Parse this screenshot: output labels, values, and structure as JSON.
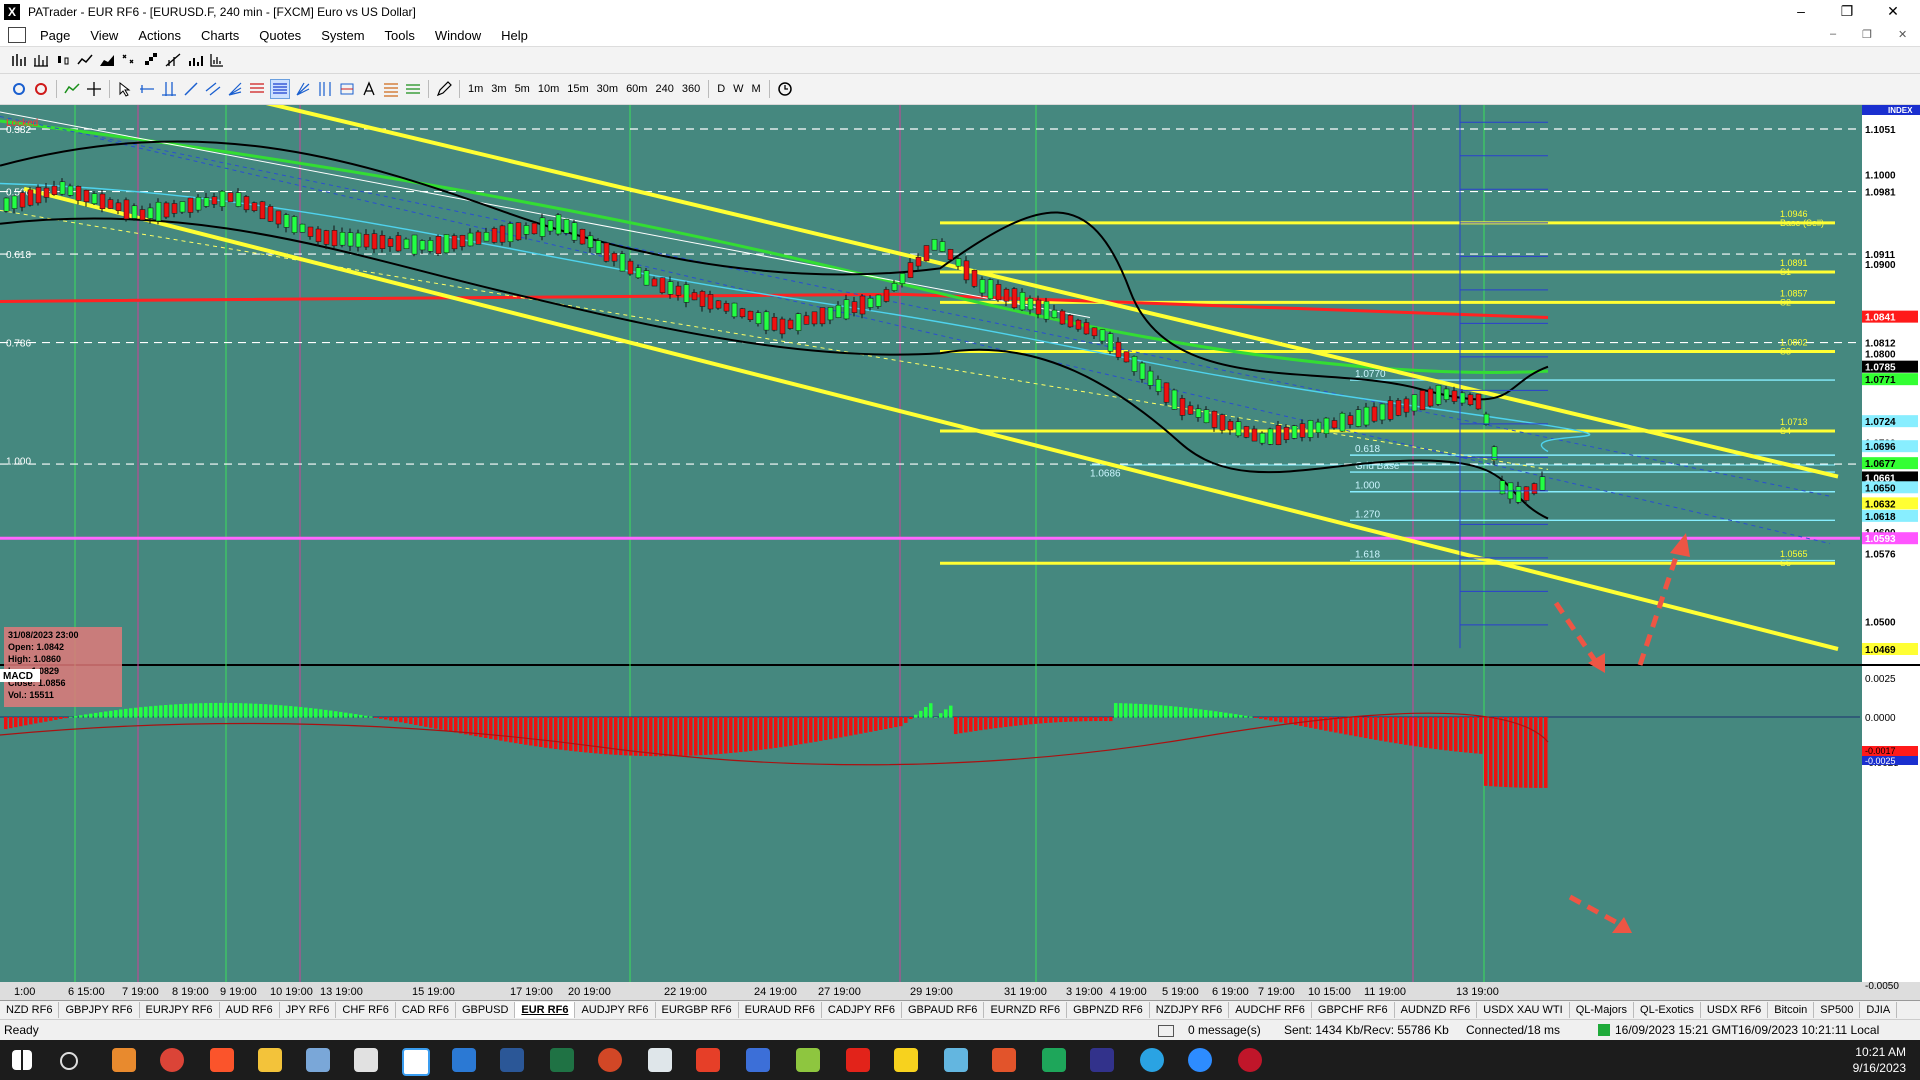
{
  "window": {
    "title": "PATrader - EUR RF6 - [EURUSD.F, 240 min - [FXCM] Euro vs US Dollar]",
    "app_icon": "X"
  },
  "menu": [
    "Page",
    "Actions",
    "Charts",
    "Quotes",
    "System",
    "Tools",
    "Window",
    "Help"
  ],
  "timeframes": [
    "1m",
    "3m",
    "5m",
    "10m",
    "15m",
    "30m",
    "60m",
    "240",
    "360",
    "D",
    "W",
    "M"
  ],
  "chart": {
    "locked_label": "Locked",
    "index_label": "INDEX",
    "price_labels": [
      {
        "text": "1.1051",
        "price": 1.1051,
        "bg": "#ffffff",
        "fg": "#000000"
      },
      {
        "text": "1.1000",
        "price": 1.1,
        "bg": "",
        "fg": "#000000"
      },
      {
        "text": "1.0981",
        "price": 1.0981,
        "bg": "#ffffff",
        "fg": "#000000"
      },
      {
        "text": "1.0911",
        "price": 1.0911,
        "bg": "#ffffff",
        "fg": "#000000"
      },
      {
        "text": "1.0900",
        "price": 1.09,
        "bg": "",
        "fg": "#000000"
      },
      {
        "text": "1.0841",
        "price": 1.0841,
        "bg": "#ff1a1a",
        "fg": "#ffffff"
      },
      {
        "text": "1.0812",
        "price": 1.0812,
        "bg": "#ffffff",
        "fg": "#000000"
      },
      {
        "text": "1.0800",
        "price": 1.08,
        "bg": "",
        "fg": "#000000"
      },
      {
        "text": "1.0785",
        "price": 1.0785,
        "bg": "#000000",
        "fg": "#ffffff"
      },
      {
        "text": "1.0771",
        "price": 1.0771,
        "bg": "#33ff33",
        "fg": "#000000"
      },
      {
        "text": "1.0724",
        "price": 1.0724,
        "bg": "#88eeff",
        "fg": "#000000"
      },
      {
        "text": "1.0700",
        "price": 1.07,
        "bg": "",
        "fg": "#000000"
      },
      {
        "text": "1.0696",
        "price": 1.0696,
        "bg": "#88eeff",
        "fg": "#000000"
      },
      {
        "text": "1.0677",
        "price": 1.0677,
        "bg": "#33ff33",
        "fg": "#000000"
      },
      {
        "text": "1.0661",
        "price": 1.0661,
        "bg": "#000000",
        "fg": "#ffffff"
      },
      {
        "text": "1.0650",
        "price": 1.065,
        "bg": "#88eeff",
        "fg": "#000000"
      },
      {
        "text": "1.0632",
        "price": 1.0632,
        "bg": "#ffff33",
        "fg": "#000000"
      },
      {
        "text": "1.0618",
        "price": 1.0618,
        "bg": "#88eeff",
        "fg": "#000000"
      },
      {
        "text": "1.0600",
        "price": 1.06,
        "bg": "",
        "fg": "#000000"
      },
      {
        "text": "1.0593",
        "price": 1.0593,
        "bg": "#ff55ff",
        "fg": "#ffffff"
      },
      {
        "text": "1.0576",
        "price": 1.0576,
        "bg": "#ffffff",
        "fg": "#000000"
      },
      {
        "text": "1.0500",
        "price": 1.05,
        "bg": "",
        "fg": "#000000"
      },
      {
        "text": "1.0469",
        "price": 1.0469,
        "bg": "#ffff33",
        "fg": "#000000"
      }
    ],
    "fib_left": [
      {
        "text": "0.382",
        "price": 1.1051
      },
      {
        "text": "0.500",
        "price": 1.0981
      },
      {
        "text": "0.618",
        "price": 1.0911
      },
      {
        "text": "0.786",
        "price": 1.0812
      },
      {
        "text": "1.000",
        "price": 1.068
      }
    ],
    "pivots": [
      {
        "text": "1.0946",
        "sub": "Base (Sell)",
        "price": 1.0946
      },
      {
        "text": "1.0891",
        "sub": "S1",
        "price": 1.0891
      },
      {
        "text": "1.0857",
        "sub": "S2",
        "price": 1.0857
      },
      {
        "text": "1.0802",
        "sub": "S3",
        "price": 1.0802
      },
      {
        "text": "1.0713",
        "sub": "S4",
        "price": 1.0713
      },
      {
        "text": "1.0565",
        "sub": "S5",
        "price": 1.0565
      }
    ],
    "grid_labels": [
      {
        "text": "1.0770",
        "price": 1.077
      },
      {
        "text": "0.618",
        "price": 1.0686
      },
      {
        "text": "Grid Base",
        "price": 1.0667
      },
      {
        "text": "1.000",
        "price": 1.0645
      },
      {
        "text": "1.270",
        "price": 1.0613
      },
      {
        "text": "1.618",
        "price": 1.0568
      }
    ],
    "fib_mid_label": "1.0686",
    "time_labels": [
      "1:00",
      "6 15:00",
      "7 19:00",
      "8 19:00",
      "9 19:00",
      "10 19:00",
      "13 19:00",
      "15 19:00",
      "17 19:00",
      "20 19:00",
      "22 19:00",
      "24 19:00",
      "27 19:00",
      "29 19:00",
      "31 19:00",
      "3 19:00",
      "4 19:00",
      "5 19:00",
      "6 19:00",
      "7 19:00",
      "10 15:00",
      "11 19:00",
      "13 19:00"
    ],
    "ohlc": {
      "date": "31/08/2023 23:00",
      "open": "Open: 1.0842",
      "high": "High: 1.0860",
      "low": "Low: 1.0829",
      "close": "Close: 1.0856",
      "vol": "Vol.: 15511"
    },
    "macd": {
      "label": "MACD",
      "levels": [
        "0.0025",
        "0.0000",
        "-0.0025",
        "-0.0050"
      ],
      "badge1": "-0.0017",
      "badge2": "-0.0025"
    }
  },
  "tabs": [
    "NZD RF6",
    "GBPJPY RF6",
    "EURJPY RF6",
    "AUD RF6",
    "JPY RF6",
    "CHF RF6",
    "CAD RF6",
    "GBPUSD",
    "EUR RF6",
    "AUDJPY RF6",
    "EURGBP RF6",
    "EURAUD RF6",
    "CADJPY RF6",
    "GBPAUD RF6",
    "EURNZD RF6",
    "GBPNZD RF6",
    "NZDJPY RF6",
    "AUDCHF RF6",
    "GBPCHF RF6",
    "AUDNZD RF6",
    "USDX XAU WTI",
    "QL-Majors",
    "QL-Exotics",
    "USDX RF6",
    "Bitcoin",
    "SP500",
    "DJIA"
  ],
  "active_tab": "EUR RF6",
  "status": {
    "ready": "Ready",
    "messages": "0 message(s)",
    "traffic": "Sent: 1434 Kb/Recv: 55786 Kb",
    "connected": "Connected/18 ms",
    "server_time": "16/09/2023 15:21 GMT",
    "local_time": "16/09/2023 10:21:11 Local"
  },
  "taskbar": {
    "time": "10:21 AM",
    "date": "9/16/2023"
  },
  "colors": {
    "chart_bg": "#45887f",
    "bull": "#22ff44",
    "bear": "#ee1111",
    "channel": "#ffff33",
    "arrow": "#ee5544"
  }
}
